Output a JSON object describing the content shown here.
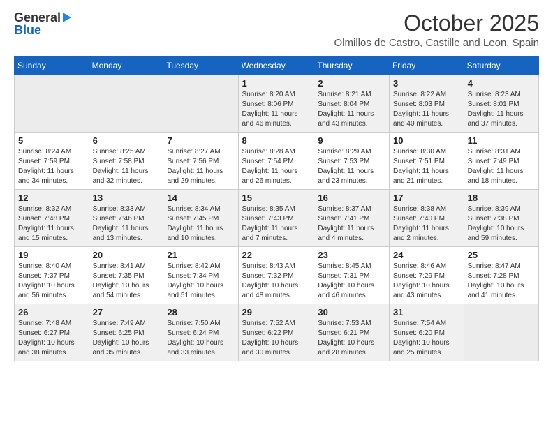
{
  "logo": {
    "general": "General",
    "blue": "Blue"
  },
  "title": "October 2025",
  "subtitle": "Olmillos de Castro, Castille and Leon, Spain",
  "days_of_week": [
    "Sunday",
    "Monday",
    "Tuesday",
    "Wednesday",
    "Thursday",
    "Friday",
    "Saturday"
  ],
  "weeks": [
    [
      {
        "day": "",
        "info": ""
      },
      {
        "day": "",
        "info": ""
      },
      {
        "day": "",
        "info": ""
      },
      {
        "day": "1",
        "info": "Sunrise: 8:20 AM\nSunset: 8:06 PM\nDaylight: 11 hours and 46 minutes."
      },
      {
        "day": "2",
        "info": "Sunrise: 8:21 AM\nSunset: 8:04 PM\nDaylight: 11 hours and 43 minutes."
      },
      {
        "day": "3",
        "info": "Sunrise: 8:22 AM\nSunset: 8:03 PM\nDaylight: 11 hours and 40 minutes."
      },
      {
        "day": "4",
        "info": "Sunrise: 8:23 AM\nSunset: 8:01 PM\nDaylight: 11 hours and 37 minutes."
      }
    ],
    [
      {
        "day": "5",
        "info": "Sunrise: 8:24 AM\nSunset: 7:59 PM\nDaylight: 11 hours and 34 minutes."
      },
      {
        "day": "6",
        "info": "Sunrise: 8:25 AM\nSunset: 7:58 PM\nDaylight: 11 hours and 32 minutes."
      },
      {
        "day": "7",
        "info": "Sunrise: 8:27 AM\nSunset: 7:56 PM\nDaylight: 11 hours and 29 minutes."
      },
      {
        "day": "8",
        "info": "Sunrise: 8:28 AM\nSunset: 7:54 PM\nDaylight: 11 hours and 26 minutes."
      },
      {
        "day": "9",
        "info": "Sunrise: 8:29 AM\nSunset: 7:53 PM\nDaylight: 11 hours and 23 minutes."
      },
      {
        "day": "10",
        "info": "Sunrise: 8:30 AM\nSunset: 7:51 PM\nDaylight: 11 hours and 21 minutes."
      },
      {
        "day": "11",
        "info": "Sunrise: 8:31 AM\nSunset: 7:49 PM\nDaylight: 11 hours and 18 minutes."
      }
    ],
    [
      {
        "day": "12",
        "info": "Sunrise: 8:32 AM\nSunset: 7:48 PM\nDaylight: 11 hours and 15 minutes."
      },
      {
        "day": "13",
        "info": "Sunrise: 8:33 AM\nSunset: 7:46 PM\nDaylight: 11 hours and 13 minutes."
      },
      {
        "day": "14",
        "info": "Sunrise: 8:34 AM\nSunset: 7:45 PM\nDaylight: 11 hours and 10 minutes."
      },
      {
        "day": "15",
        "info": "Sunrise: 8:35 AM\nSunset: 7:43 PM\nDaylight: 11 hours and 7 minutes."
      },
      {
        "day": "16",
        "info": "Sunrise: 8:37 AM\nSunset: 7:41 PM\nDaylight: 11 hours and 4 minutes."
      },
      {
        "day": "17",
        "info": "Sunrise: 8:38 AM\nSunset: 7:40 PM\nDaylight: 11 hours and 2 minutes."
      },
      {
        "day": "18",
        "info": "Sunrise: 8:39 AM\nSunset: 7:38 PM\nDaylight: 10 hours and 59 minutes."
      }
    ],
    [
      {
        "day": "19",
        "info": "Sunrise: 8:40 AM\nSunset: 7:37 PM\nDaylight: 10 hours and 56 minutes."
      },
      {
        "day": "20",
        "info": "Sunrise: 8:41 AM\nSunset: 7:35 PM\nDaylight: 10 hours and 54 minutes."
      },
      {
        "day": "21",
        "info": "Sunrise: 8:42 AM\nSunset: 7:34 PM\nDaylight: 10 hours and 51 minutes."
      },
      {
        "day": "22",
        "info": "Sunrise: 8:43 AM\nSunset: 7:32 PM\nDaylight: 10 hours and 48 minutes."
      },
      {
        "day": "23",
        "info": "Sunrise: 8:45 AM\nSunset: 7:31 PM\nDaylight: 10 hours and 46 minutes."
      },
      {
        "day": "24",
        "info": "Sunrise: 8:46 AM\nSunset: 7:29 PM\nDaylight: 10 hours and 43 minutes."
      },
      {
        "day": "25",
        "info": "Sunrise: 8:47 AM\nSunset: 7:28 PM\nDaylight: 10 hours and 41 minutes."
      }
    ],
    [
      {
        "day": "26",
        "info": "Sunrise: 7:48 AM\nSunset: 6:27 PM\nDaylight: 10 hours and 38 minutes."
      },
      {
        "day": "27",
        "info": "Sunrise: 7:49 AM\nSunset: 6:25 PM\nDaylight: 10 hours and 35 minutes."
      },
      {
        "day": "28",
        "info": "Sunrise: 7:50 AM\nSunset: 6:24 PM\nDaylight: 10 hours and 33 minutes."
      },
      {
        "day": "29",
        "info": "Sunrise: 7:52 AM\nSunset: 6:22 PM\nDaylight: 10 hours and 30 minutes."
      },
      {
        "day": "30",
        "info": "Sunrise: 7:53 AM\nSunset: 6:21 PM\nDaylight: 10 hours and 28 minutes."
      },
      {
        "day": "31",
        "info": "Sunrise: 7:54 AM\nSunset: 6:20 PM\nDaylight: 10 hours and 25 minutes."
      },
      {
        "day": "",
        "info": ""
      }
    ]
  ]
}
